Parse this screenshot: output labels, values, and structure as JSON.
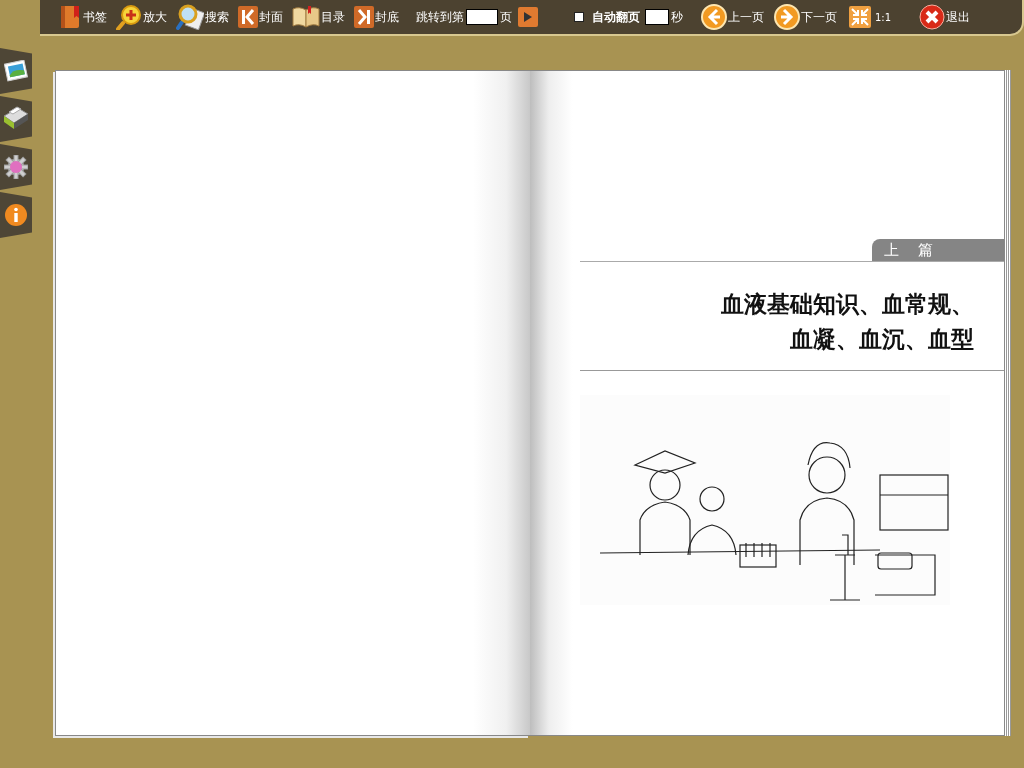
{
  "toolbar": {
    "buttons": [
      {
        "label": "书签"
      },
      {
        "label": "放大"
      },
      {
        "label": "搜索"
      },
      {
        "label": "封面"
      },
      {
        "label": "目录"
      },
      {
        "label": "封底"
      }
    ],
    "page_jump": {
      "label": "跳转到第",
      "suffix": "页"
    },
    "auto_flip": {
      "label": "自动翻页",
      "checked": false,
      "unit": "秒"
    },
    "nav_buttons": [
      {
        "label": "上一页"
      },
      {
        "label": "下一页"
      },
      {
        "label": "1:1"
      },
      {
        "label": "退出"
      }
    ]
  },
  "book": {
    "right_page": {
      "part_tag": "上　篇",
      "title_lines": [
        "血液基础知识、血常规、",
        "血凝、血沉、血型"
      ]
    }
  }
}
